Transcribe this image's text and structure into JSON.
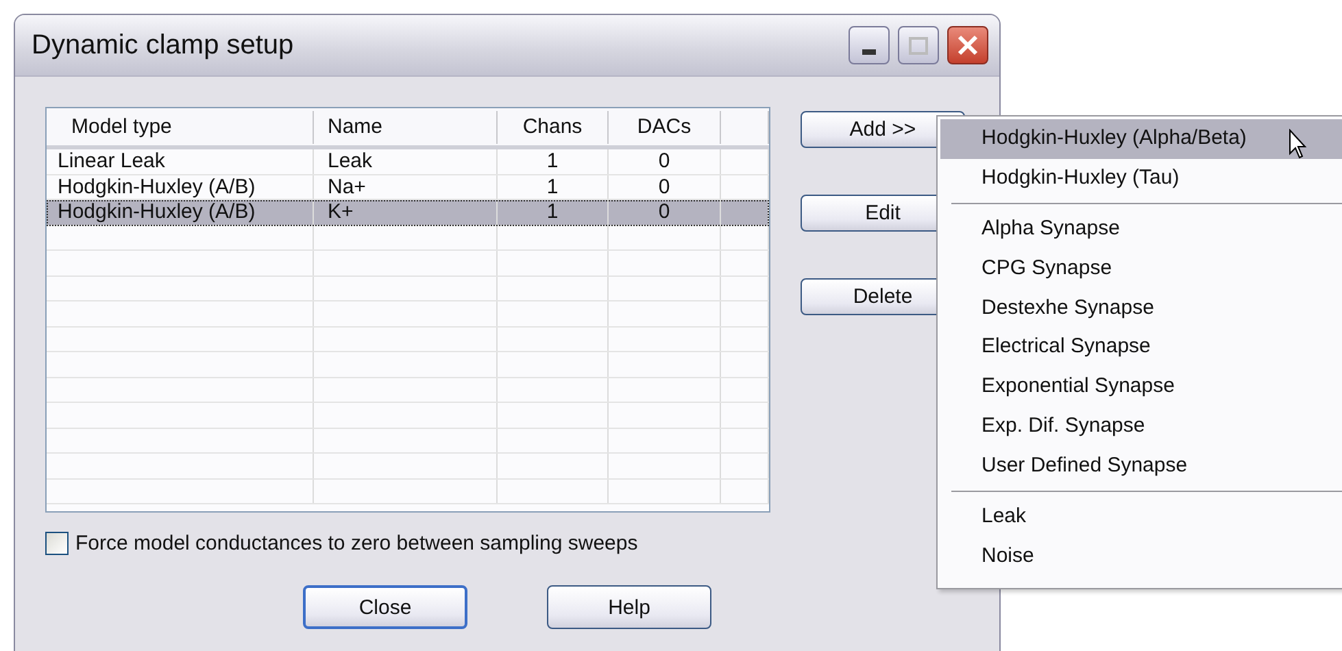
{
  "window": {
    "title": "Dynamic clamp setup"
  },
  "table": {
    "columns": [
      "Model type",
      "Name",
      "Chans",
      "DACs"
    ],
    "rows": [
      {
        "cells": [
          "Linear Leak",
          "Leak",
          "1",
          "0"
        ],
        "selected": false
      },
      {
        "cells": [
          "Hodgkin-Huxley (A/B)",
          "Na+",
          "1",
          "0"
        ],
        "selected": false
      },
      {
        "cells": [
          "Hodgkin-Huxley (A/B)",
          "K+",
          "1",
          "0"
        ],
        "selected": true
      }
    ]
  },
  "side_buttons": [
    "Add >>",
    "Edit",
    "Delete"
  ],
  "checkbox": {
    "label": "Force model conductances to zero between sampling sweeps",
    "checked": false
  },
  "bottom_buttons": [
    {
      "label": "Close",
      "default": true
    },
    {
      "label": "Help",
      "default": false
    }
  ],
  "menu": {
    "items": [
      {
        "kind": "item",
        "label": "Hodgkin-Huxley (Alpha/Beta)",
        "selected": true
      },
      {
        "kind": "item",
        "label": "Hodgkin-Huxley (Tau)",
        "selected": false
      },
      {
        "kind": "separator"
      },
      {
        "kind": "item",
        "label": "Alpha Synapse",
        "selected": false
      },
      {
        "kind": "item",
        "label": "CPG Synapse",
        "selected": false
      },
      {
        "kind": "item",
        "label": "Destexhe Synapse",
        "selected": false
      },
      {
        "kind": "item",
        "label": "Electrical Synapse",
        "selected": false
      },
      {
        "kind": "item",
        "label": "Exponential Synapse",
        "selected": false
      },
      {
        "kind": "item",
        "label": "Exp. Dif. Synapse",
        "selected": false
      },
      {
        "kind": "item",
        "label": "User Defined Synapse",
        "selected": false
      },
      {
        "kind": "separator"
      },
      {
        "kind": "item",
        "label": "Leak",
        "selected": false
      },
      {
        "kind": "item",
        "label": "Noise",
        "selected": false
      }
    ]
  }
}
